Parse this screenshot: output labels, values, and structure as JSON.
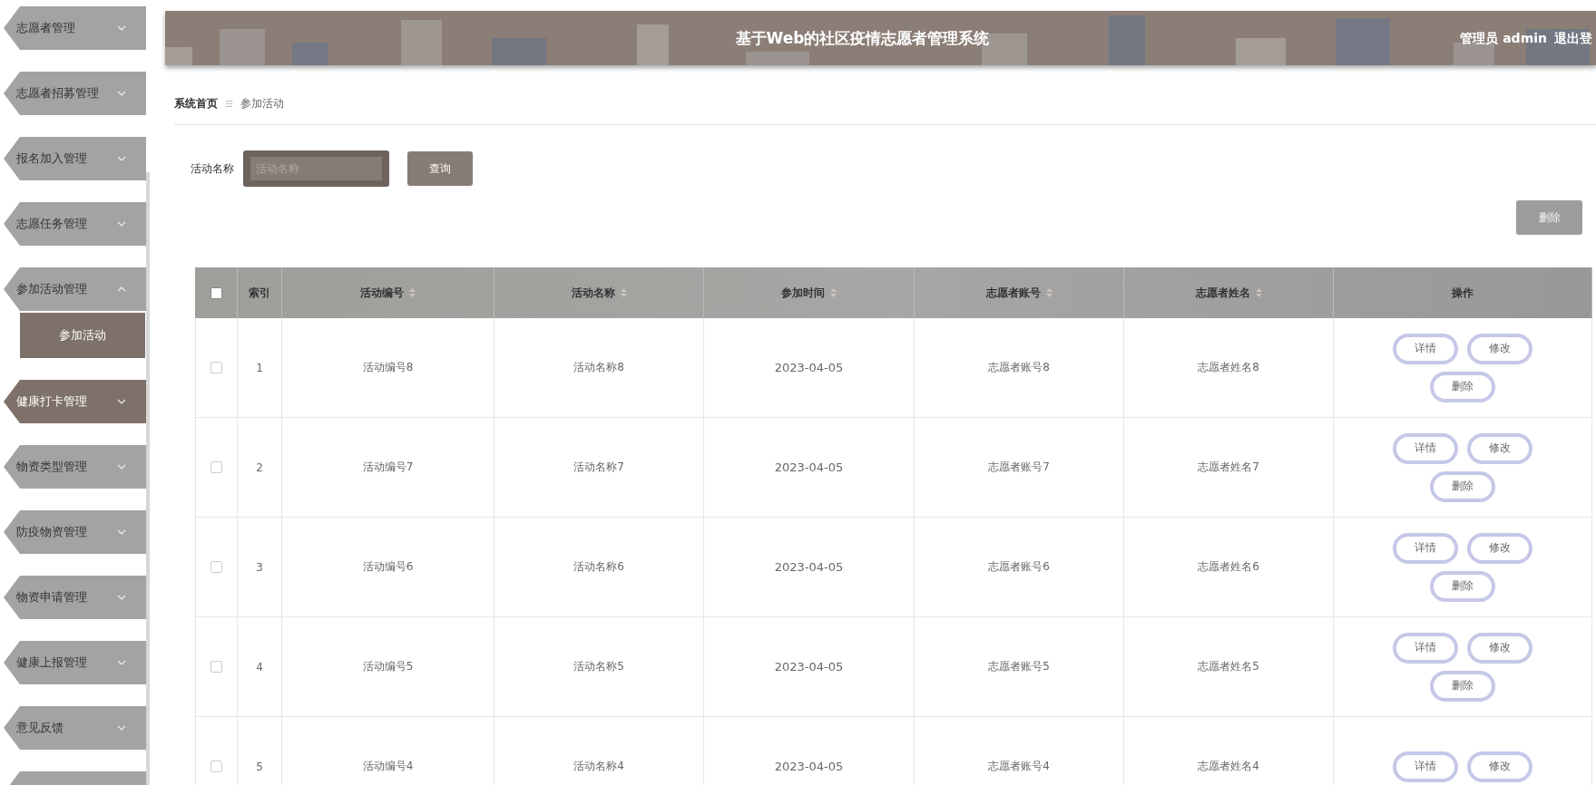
{
  "sidebar": {
    "items": [
      {
        "label": "志愿者管理",
        "expanded": false,
        "hovered": false
      },
      {
        "label": "志愿者招募管理",
        "expanded": false,
        "hovered": false
      },
      {
        "label": "报名加入管理",
        "expanded": false,
        "hovered": false
      },
      {
        "label": "志愿任务管理",
        "expanded": false,
        "hovered": false
      },
      {
        "label": "参加活动管理",
        "expanded": true,
        "hovered": false,
        "children": [
          {
            "label": "参加活动",
            "selected": true
          }
        ]
      },
      {
        "label": "健康打卡管理",
        "expanded": false,
        "hovered": true
      },
      {
        "label": "物资类型管理",
        "expanded": false,
        "hovered": false
      },
      {
        "label": "防疫物资管理",
        "expanded": false,
        "hovered": false
      },
      {
        "label": "物资申请管理",
        "expanded": false,
        "hovered": false
      },
      {
        "label": "健康上报管理",
        "expanded": false,
        "hovered": false
      },
      {
        "label": "意见反馈",
        "expanded": false,
        "hovered": false
      }
    ]
  },
  "header": {
    "title": "基于Web的社区疫情志愿者管理系统",
    "user": "管理员 admin",
    "logout": "退出登"
  },
  "breadcrumb": [
    "系统首页",
    "参加活动"
  ],
  "breadcrumb_separator": "☰",
  "search": {
    "label": "活动名称",
    "placeholder": "活动名称",
    "button": "查询"
  },
  "delete_button": "删除",
  "table": {
    "columns": [
      {
        "label": "索引",
        "sortable": false
      },
      {
        "label": "活动编号",
        "sortable": true
      },
      {
        "label": "活动名称",
        "sortable": true
      },
      {
        "label": "参加时间",
        "sortable": true
      },
      {
        "label": "志愿者账号",
        "sortable": true
      },
      {
        "label": "志愿者姓名",
        "sortable": true
      },
      {
        "label": "操作",
        "sortable": false
      }
    ],
    "select_all": false,
    "rows": [
      {
        "checked": false,
        "cells": [
          "1",
          "活动编号8",
          "活动名称8",
          "2023-04-05",
          "志愿者账号8",
          "志愿者姓名8"
        ],
        "actions": [
          "详情",
          "修改",
          "删除"
        ]
      },
      {
        "checked": false,
        "cells": [
          "2",
          "活动编号7",
          "活动名称7",
          "2023-04-05",
          "志愿者账号7",
          "志愿者姓名7"
        ],
        "actions": [
          "详情",
          "修改",
          "删除"
        ]
      },
      {
        "checked": false,
        "cells": [
          "3",
          "活动编号6",
          "活动名称6",
          "2023-04-05",
          "志愿者账号6",
          "志愿者姓名6"
        ],
        "actions": [
          "详情",
          "修改",
          "删除"
        ]
      },
      {
        "checked": false,
        "cells": [
          "4",
          "活动编号5",
          "活动名称5",
          "2023-04-05",
          "志愿者账号5",
          "志愿者姓名5"
        ],
        "actions": [
          "详情",
          "修改",
          "删除"
        ]
      },
      {
        "checked": false,
        "cells": [
          "5",
          "活动编号4",
          "活动名称4",
          "2023-04-05",
          "志愿者账号4",
          "志愿者姓名4"
        ],
        "actions": [
          "详情",
          "修改"
        ]
      }
    ]
  }
}
